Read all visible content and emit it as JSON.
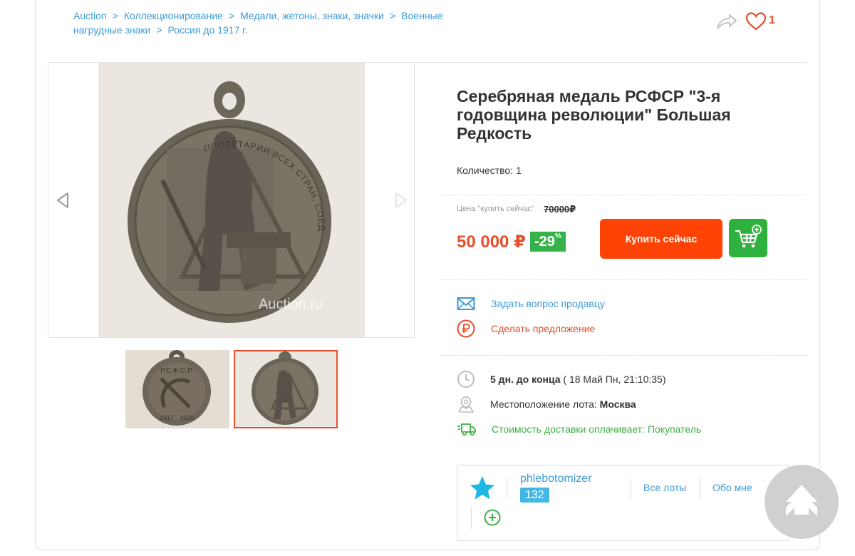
{
  "breadcrumb": [
    {
      "label": "Auction"
    },
    {
      "label": "Коллекционирование"
    },
    {
      "label": "Медали, жетоны, знаки, значки"
    },
    {
      "label": "Военные нагрудные знаки"
    },
    {
      "label": "Россия до 1917 г."
    }
  ],
  "breadcrumb_separator": ">",
  "favorites_count": "1",
  "lot": {
    "title": "Серебряная медаль РСФСР \"3-я годовщина революции\" Большая Редкость",
    "quantity_label": "Количество:",
    "quantity_value": "1"
  },
  "photo": {
    "watermark": "Auction.ru",
    "medal_inscription": "ПРОЛЕТАРИИ ВСЕХ СТРАН, СОЕДИНЯЙТЕСЬ!",
    "thumb1_inscription": "Р.С.Ф.С.Р.",
    "thumb1_years": "1917 · 1920"
  },
  "price": {
    "caption": "Цена \"купить сейчас\"",
    "old_price": "70000₽",
    "current": "50 000 ₽",
    "discount": "-29",
    "discount_unit": "%"
  },
  "buttons": {
    "buy_now": "Купить сейчас"
  },
  "actions": {
    "ask_seller": "Задать вопрос продавцу",
    "make_offer": "Сделать предложение"
  },
  "info": {
    "time_bold": "5 дн. до конца",
    "time_detail": " ( 18 Май Пн, 21:10:35)",
    "location_label": "Местоположение лота: ",
    "location_value": "Москва",
    "shipping": "Стоимость доставки оплачивает: Покупатель"
  },
  "seller": {
    "name": "phlebotomizer",
    "rating": "132",
    "all_lots": "Все лоты",
    "about": "Обо мне"
  },
  "colors": {
    "link": "#3d9ad6",
    "accent": "#e84e2c",
    "buy_button": "#ff4306",
    "success": "#2fb13d",
    "seller_star": "#1eb7e6"
  },
  "icons": [
    "share-icon",
    "heart-icon",
    "expand-icon",
    "chevron-left-icon",
    "chevron-right-icon",
    "cart-icon",
    "envelope-icon",
    "ruble-circle-icon",
    "clock-icon",
    "map-pin-icon",
    "truck-icon",
    "star-icon",
    "plus-circle-icon",
    "arrow-up-icon"
  ]
}
